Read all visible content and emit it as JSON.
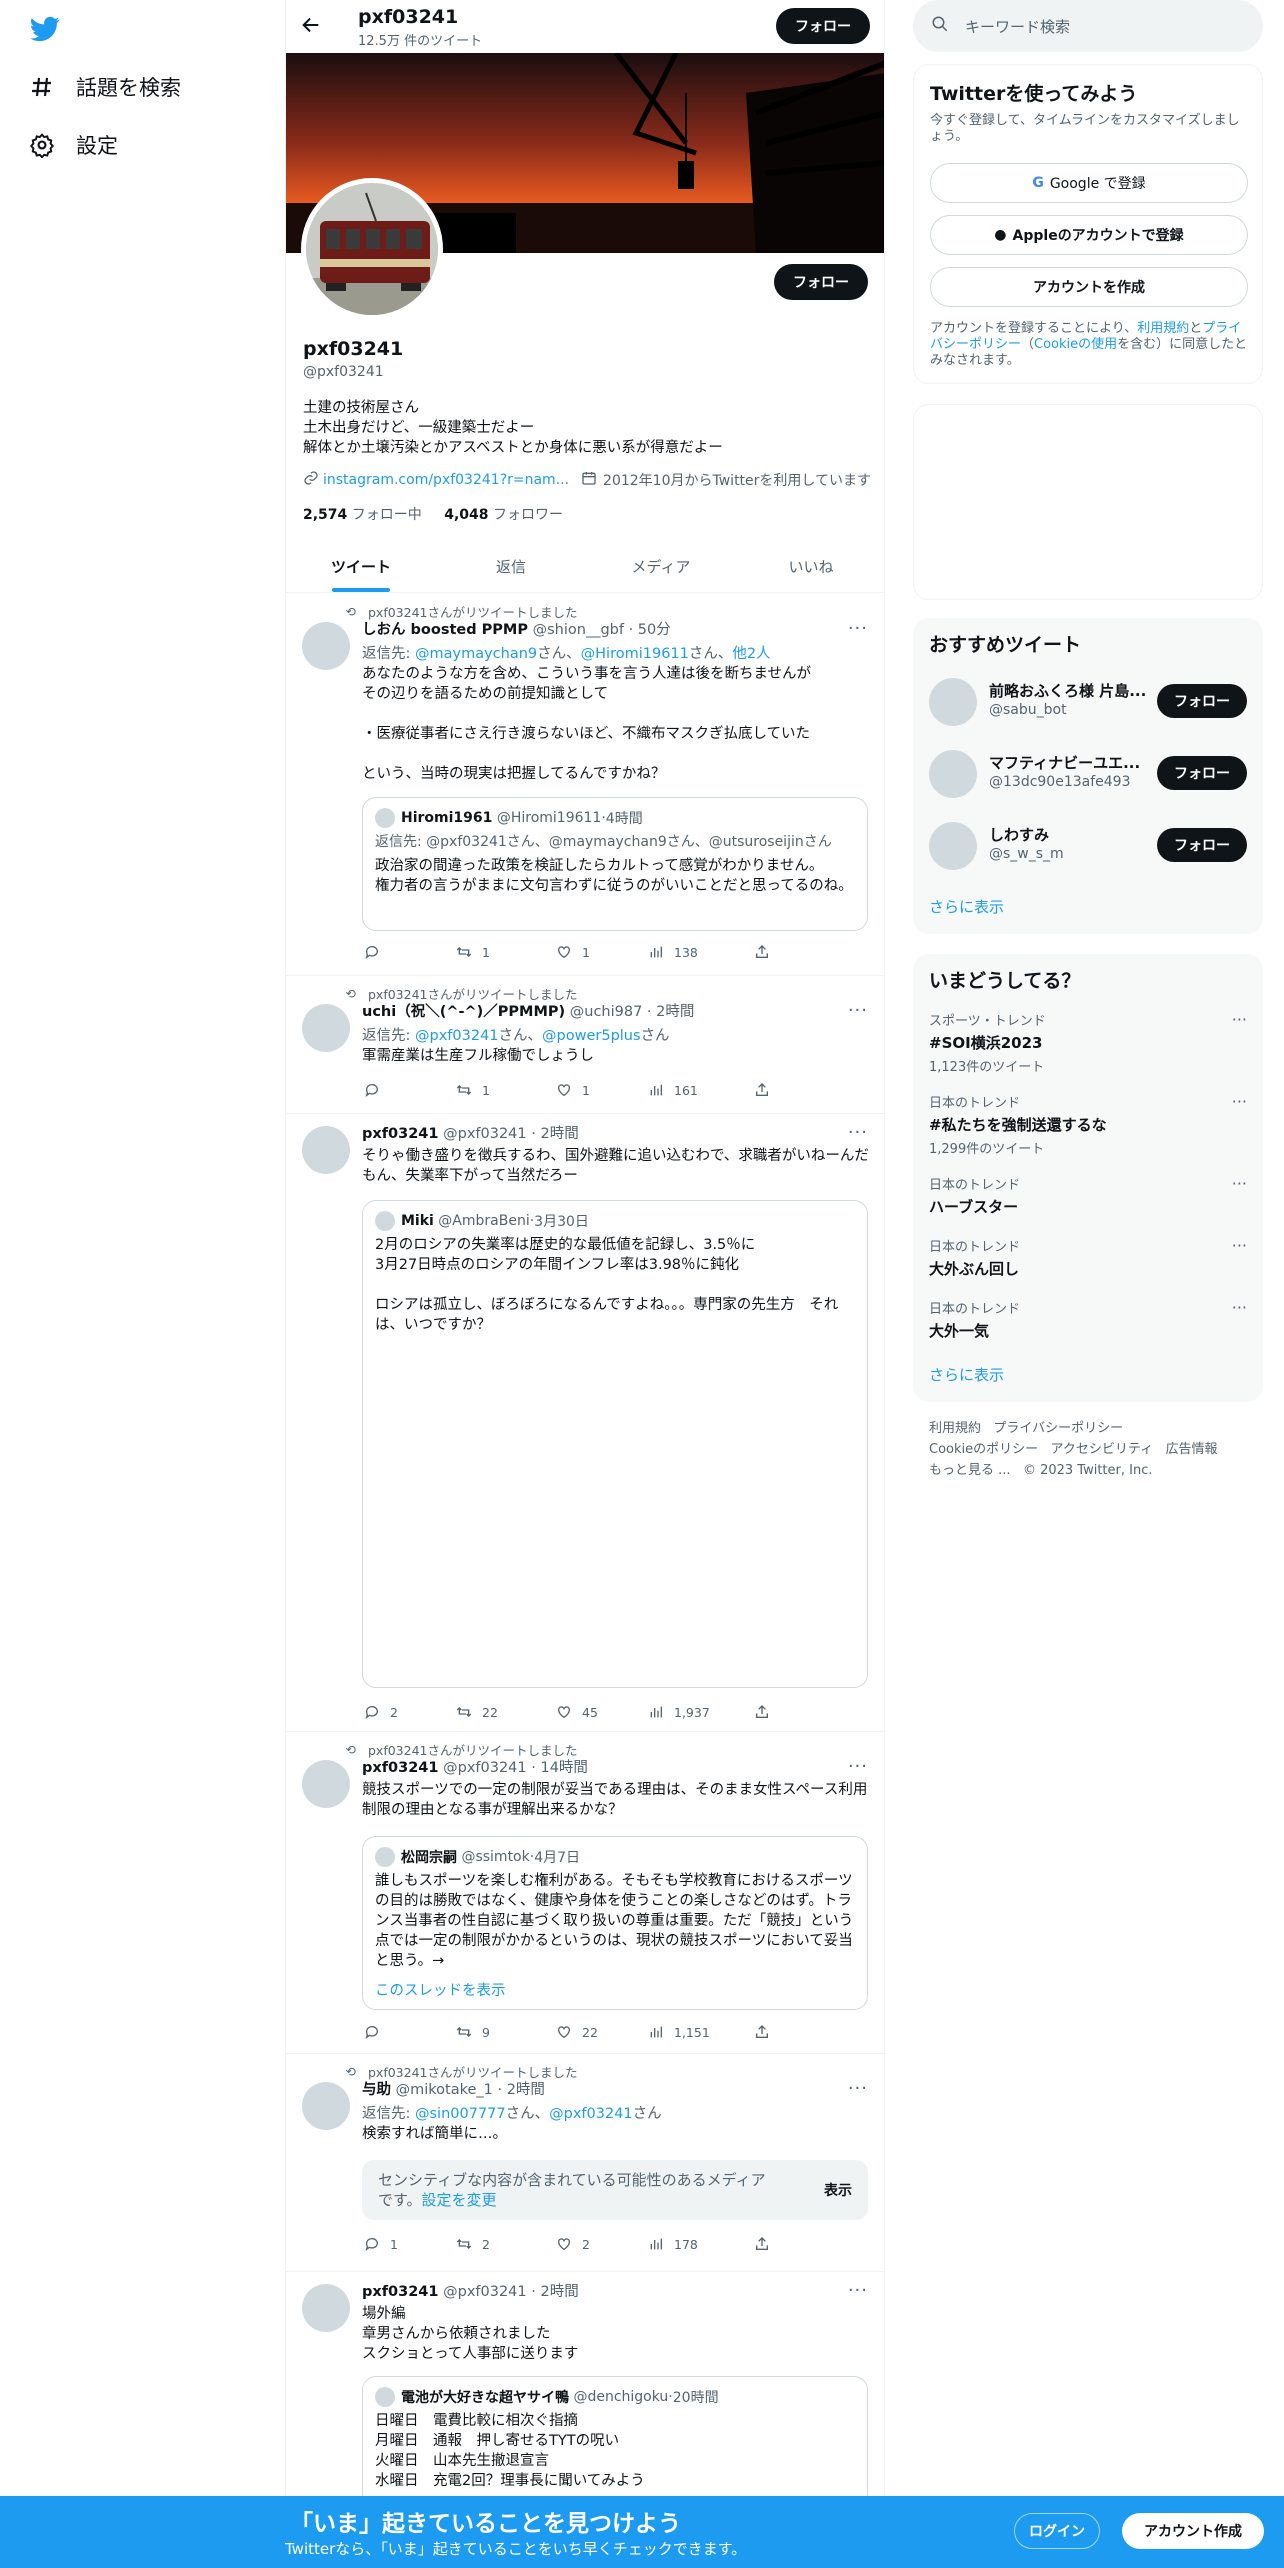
{
  "nav": {
    "explore": "話題を検索",
    "settings": "設定"
  },
  "header": {
    "name": "pxf03241",
    "count": "12.5万 件のツイート",
    "follow": "フォロー"
  },
  "profile": {
    "name": "pxf03241",
    "handle": "@pxf03241",
    "bio": "土建の技術屋さん\n土木出身だけど、一級建築士だよー\n解体とか土壌汚染とかアスベストとか身体に悪い系が得意だよー",
    "link": "instagram.com/pxf03241?r=nam...",
    "joined": "2012年10月からTwitterを利用しています",
    "following_count": "2,574",
    "following_label": "フォロー中",
    "followers_count": "4,048",
    "followers_label": "フォロワー",
    "follow": "フォロー"
  },
  "tabs": [
    "ツイート",
    "返信",
    "メディア",
    "いいね"
  ],
  "retweeted_label": "pxf03241さんがリツイートしました",
  "reply_to": "返信先:",
  "tweets": [
    {
      "name": "しおん boosted PPMP",
      "handle": "@shion__gbf",
      "time": "50分",
      "reply_a": "@maymaychan9",
      "reply_mid": "さん、",
      "reply_b": "@Hiromi19611",
      "reply_c": "さん、",
      "reply_d": "他2人",
      "text": "あなたのような方を含め、こういう事を言う人達は後を断ちませんが\nその辺りを語るための前提知識として\n\n・医療従事者にさえ行き渡らないほど、不織布マスクぎ払底していた\n\nという、当時の現実は把握してるんですかね？",
      "quote": {
        "name": "Hiromi1961",
        "handle": "@Hiromi19611",
        "time": "4時間",
        "reply": "返信先: @pxf03241さん、@maymaychan9さん、@utsuroseijinさん",
        "text": "政治家の間違った政策を検証したらカルトって感覚がわかりません。\n権力者の言うがままに文句言わずに従うのがいいことだと思ってるのね。"
      },
      "replies": "",
      "retweets": "1",
      "likes": "1",
      "views": "138"
    },
    {
      "name": "uchi（祝＼(^-^)／PPMMP)",
      "handle": "@uchi987",
      "time": "2時間",
      "reply_a": "@pxf03241",
      "reply_mid": "さん、",
      "reply_b": "@power5plus",
      "reply_c": "さん",
      "text": "軍需産業は生産フル稼働でしょうし",
      "replies": "",
      "retweets": "1",
      "likes": "1",
      "views": "161"
    },
    {
      "name": "pxf03241",
      "handle": "@pxf03241",
      "time": "2時間",
      "text": "そりゃ働き盛りを徴兵するわ、国外避難に追い込むわで、求職者がいねーんだもん、失業率下がって当然だろー",
      "quote": {
        "name": "Miki",
        "handle": "@AmbraBeni",
        "time": "3月30日",
        "text": "2月のロシアの失業率は歴史的な最低値を記録し、3.5％に\n3月27日時点のロシアの年間インフレ率は3.98％に鈍化\n\nロシアは孤立し、ぼろぼろになるんですよね。。。専門家の先生方　それは、いつですか？"
      },
      "replies": "2",
      "retweets": "22",
      "likes": "45",
      "views": "1,937"
    },
    {
      "name": "pxf03241",
      "handle": "@pxf03241",
      "time": "14時間",
      "text": "競技スポーツでの一定の制限が妥当である理由は、そのまま女性スペース利用制限の理由となる事が理解出来るかな？",
      "quote": {
        "name": "松岡宗嗣",
        "handle": "@ssimtok",
        "time": "4月7日",
        "text": "誰しもスポーツを楽しむ権利がある。そもそも学校教育におけるスポーツの目的は勝敗ではなく、健康や身体を使うことの楽しさなどのはず。トランス当事者の性自認に基づく取り扱いの尊重は重要。ただ「競技」という点では一定の制限がかかるというのは、現状の競技スポーツにおいて妥当と思う。→",
        "thread": "このスレッドを表示"
      },
      "replies": "",
      "retweets": "9",
      "likes": "22",
      "views": "1,151"
    },
    {
      "name": "与助",
      "handle": "@mikotake_1",
      "time": "2時間",
      "reply_a": "@sin007777",
      "reply_mid": "さん、",
      "reply_b": "@pxf03241",
      "reply_c": "さん",
      "text": "検索すれば簡単に…。",
      "sensitive": "センシティブな内容が含まれている可能性のあるメディアです。",
      "sensitive_link": "設定を変更",
      "show": "表示",
      "replies": "1",
      "retweets": "2",
      "likes": "2",
      "views": "178"
    },
    {
      "name": "pxf03241",
      "handle": "@pxf03241",
      "time": "2時間",
      "text": "場外編\n章男さんから依頼されました\nスクショとって人事部に送ります",
      "quote": {
        "name": "電池が大好きな超ヤサイ鴨",
        "handle": "@denchigoku",
        "time": "20時間",
        "text": "日曜日　電費比較に相次ぐ指摘\n月曜日　通報　押し寄せるTYTの呪い\n火曜日　山本先生撤退宣言\n水曜日　充電2回？理事長に聞いてみよう"
      }
    }
  ],
  "right": {
    "search_placeholder": "キーワード検索",
    "signup": {
      "title": "Twitterを使ってみよう",
      "sub": "今すぐ登録して、タイムラインをカスタマイズしましょう。",
      "google": "Google で登録",
      "apple": "Appleのアカウントで登録",
      "create": "アカウントを作成",
      "legal_a": "アカウントを登録することにより、",
      "legal_terms": "利用規約",
      "legal_b": "と",
      "legal_privacy": "プライバシーポリシー",
      "legal_c": "（",
      "legal_cookie": "Cookieの使用",
      "legal_d": "を含む）に同意したとみなされます。"
    },
    "recommend": {
      "title": "おすすめツイート",
      "follow": "フォロー",
      "more": "さらに表示",
      "users": [
        {
          "name": "前略おふくろ様 片島...",
          "handle": "@sabu_bot"
        },
        {
          "name": "マフティナビーユエ...",
          "handle": "@13dc90e13afe493"
        },
        {
          "name": "しわすみ",
          "handle": "@s_w_s_m"
        }
      ]
    },
    "trends": {
      "title": "いまどうしてる？",
      "more": "さらに表示",
      "items": [
        {
          "cat": "スポーツ・トレンド",
          "topic": "#SOI横浜2023",
          "count": "1,123件のツイート"
        },
        {
          "cat": "日本のトレンド",
          "topic": "#私たちを強制送還するな",
          "count": "1,299件のツイート"
        },
        {
          "cat": "日本のトレンド",
          "topic": "ハーブスター",
          "count": ""
        },
        {
          "cat": "日本のトレンド",
          "topic": "大外ぶん回し",
          "count": ""
        },
        {
          "cat": "日本のトレンド",
          "topic": "大外一気",
          "count": ""
        }
      ]
    },
    "footer": {
      "terms": "利用規約",
      "privacy": "プライバシーポリシー",
      "cookie": "Cookieのポリシー",
      "access": "アクセシビリティ",
      "ads": "広告情報",
      "more": "もっと見る ...",
      "copy": "© 2023 Twitter, Inc."
    }
  },
  "bottom": {
    "title": "「いま」起きていることを見つけよう",
    "sub": "Twitterなら、「いま」起きていることをいち早くチェックできます。",
    "login": "ログイン",
    "signup": "アカウント作成"
  },
  "colors": {
    "accent": "#1d9bf0",
    "text": "#0f1419",
    "muted": "#536471"
  }
}
